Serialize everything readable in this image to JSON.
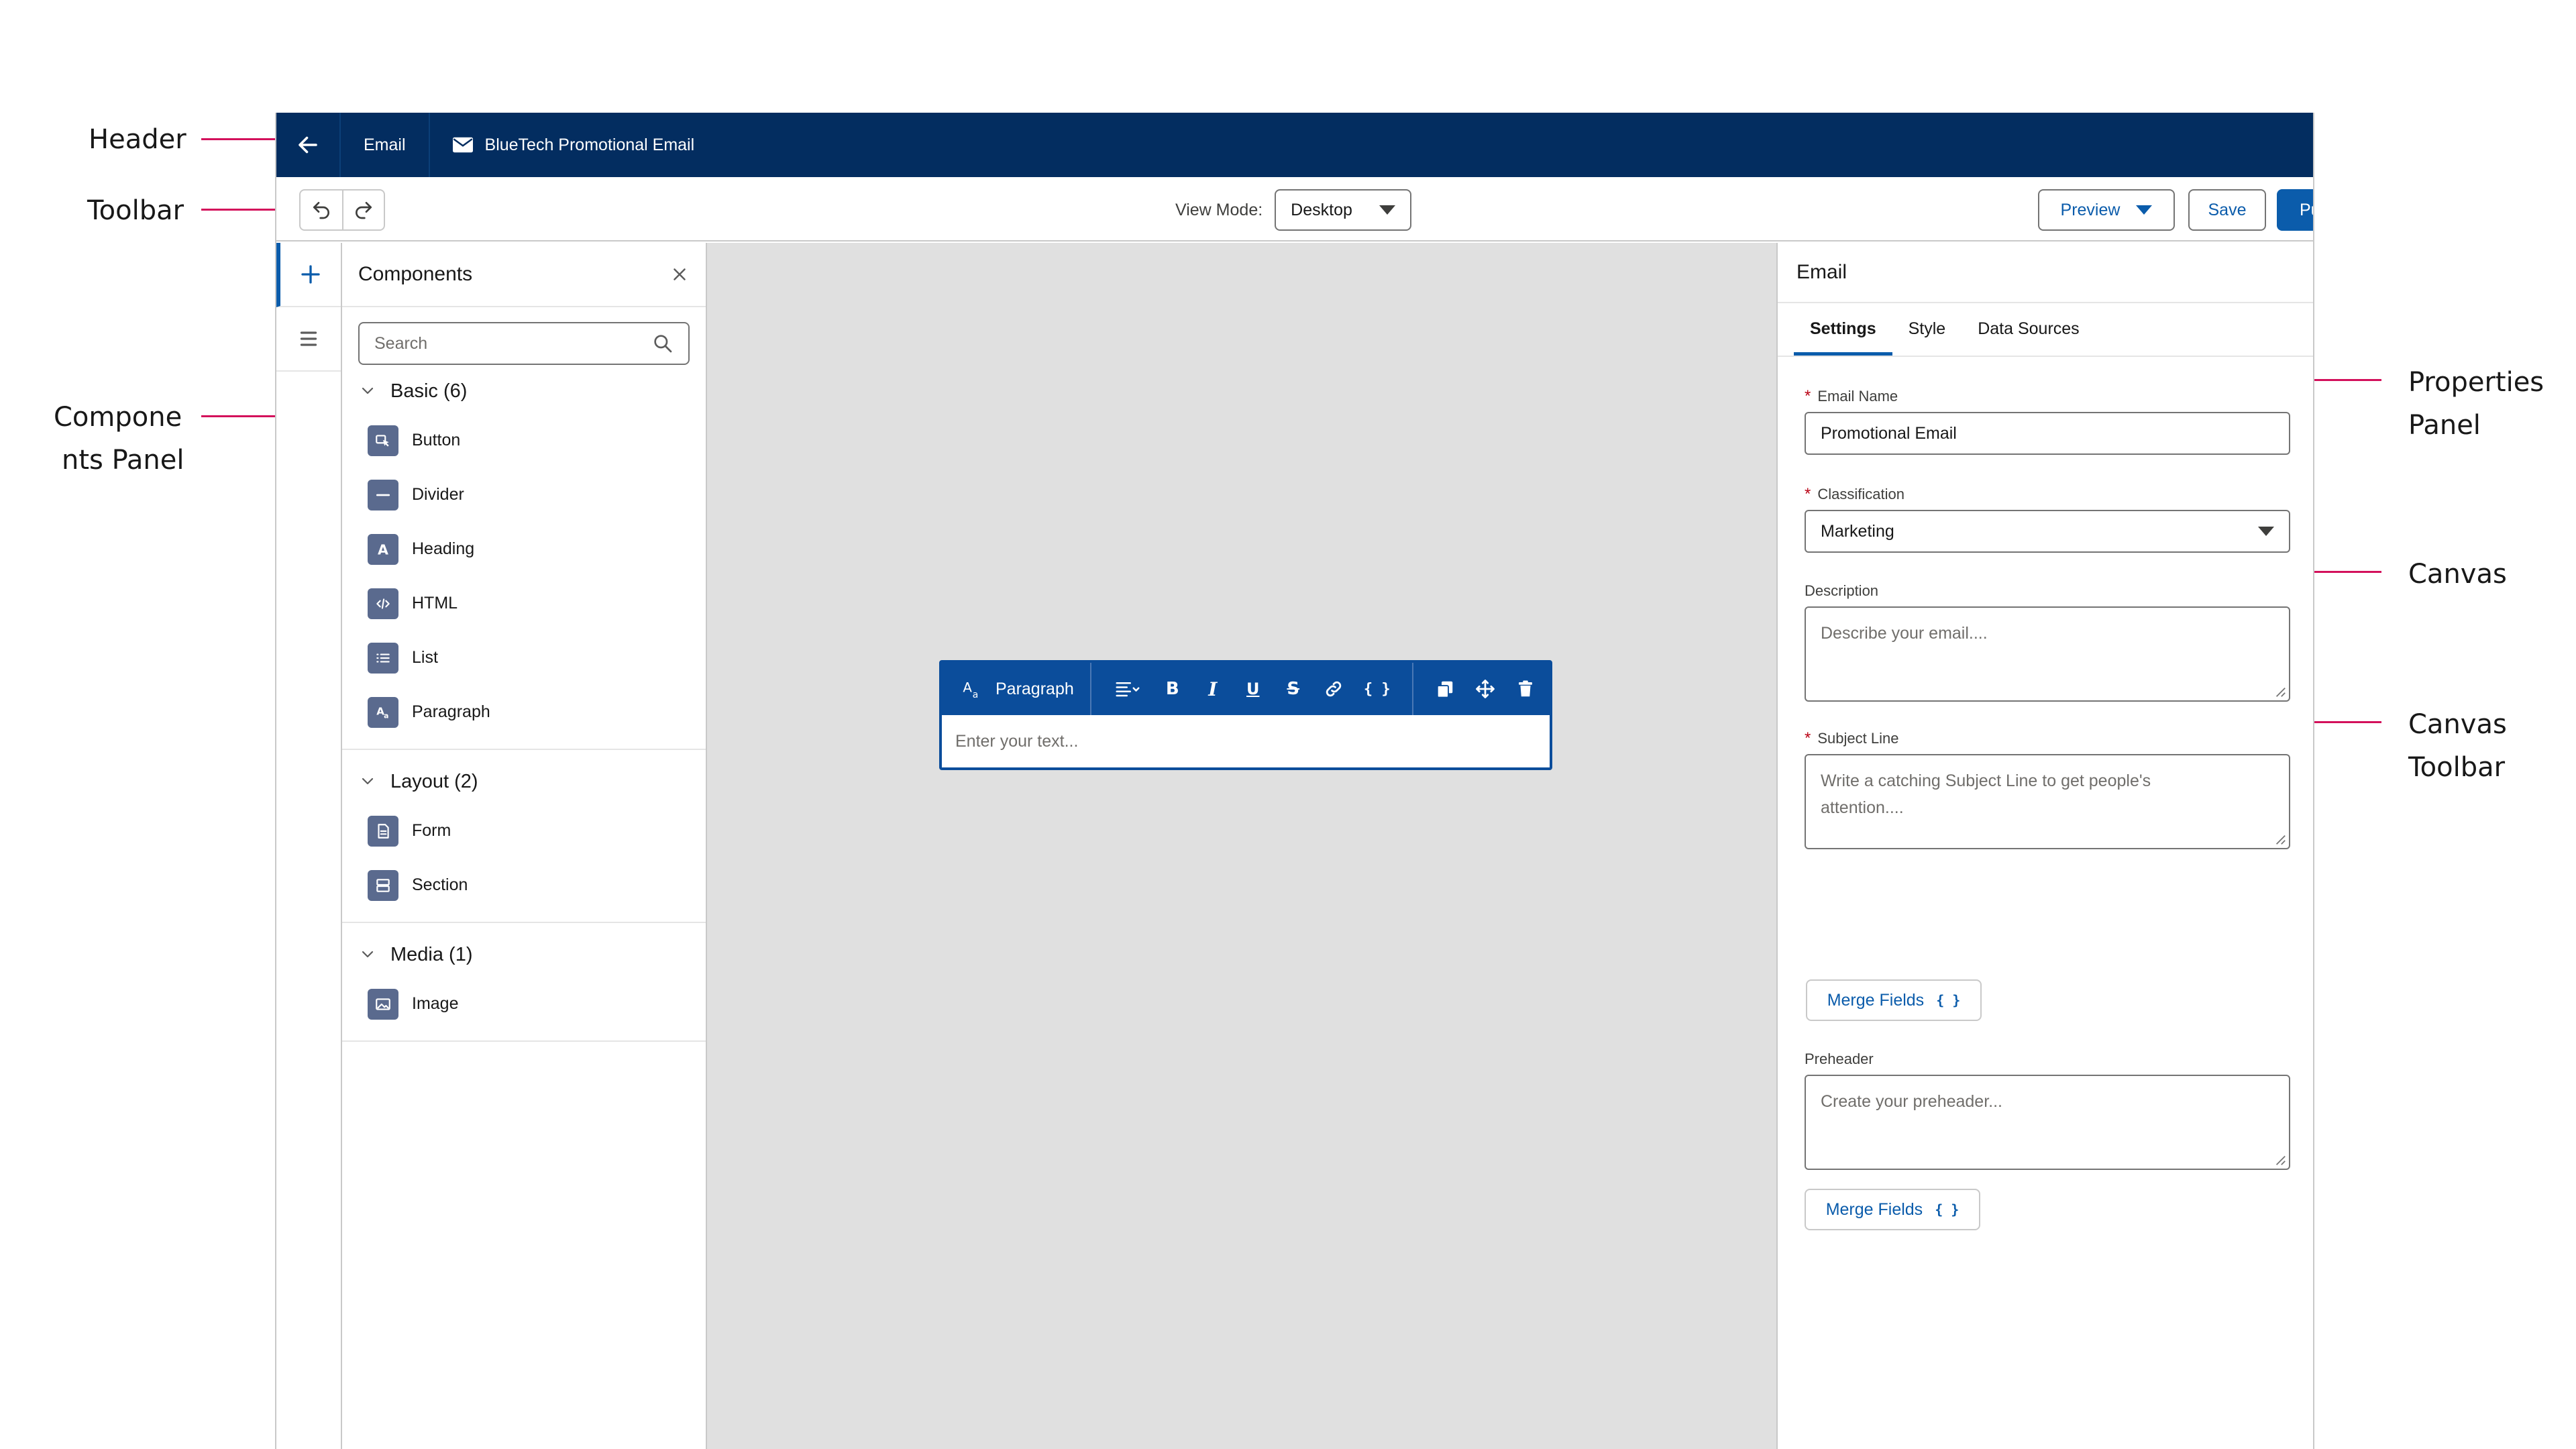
{
  "annotations": {
    "header": "Header",
    "toolbar": "Toolbar",
    "components_panel_line1": "Compone",
    "components_panel_line2": "nts Panel",
    "properties_panel_line1": "Properties",
    "properties_panel_line2": "Panel",
    "canvas": "Canvas",
    "canvas_toolbar_line1": "Canvas",
    "canvas_toolbar_line2": "Toolbar",
    "color": "#d3105b"
  },
  "header": {
    "back_icon": "arrow-left-icon",
    "tab_email": "Email",
    "title": "BlueTech Promotional Email",
    "title_icon": "envelope-icon",
    "bg_color": "#032d60"
  },
  "toolbar": {
    "view_mode_label": "View Mode:",
    "view_mode_value": "Desktop",
    "preview_label": "Preview",
    "save_label": "Save",
    "publish_label": "Publish",
    "brand_color": "#0b5cab"
  },
  "components": {
    "title": "Components",
    "search_placeholder": "Search",
    "sections": [
      {
        "title": "Basic (6)",
        "items": [
          "Button",
          "Divider",
          "Heading",
          "HTML",
          "List",
          "Paragraph"
        ]
      },
      {
        "title": "Layout (2)",
        "items": [
          "Form",
          "Section"
        ]
      },
      {
        "title": "Media (1)",
        "items": [
          "Image"
        ]
      }
    ]
  },
  "canvas": {
    "toolbar_format": "Paragraph",
    "text_placeholder": "Enter your text...",
    "bg_color": "#e0e0e0"
  },
  "properties": {
    "title": "Email",
    "tabs": [
      "Settings",
      "Style",
      "Data Sources"
    ],
    "active_tab": "Settings",
    "email_name_label": "Email Name",
    "email_name_value": "Promotional Email",
    "classification_label": "Classification",
    "classification_value": "Marketing",
    "description_label": "Description",
    "description_placeholder": "Describe your email....",
    "subject_label": "Subject Line",
    "subject_placeholder": "Write a catching Subject Line to get people's attention....",
    "merge_fields_label": "Merge Fields",
    "preheader_label": "Preheader",
    "preheader_placeholder": "Create your preheader..."
  }
}
